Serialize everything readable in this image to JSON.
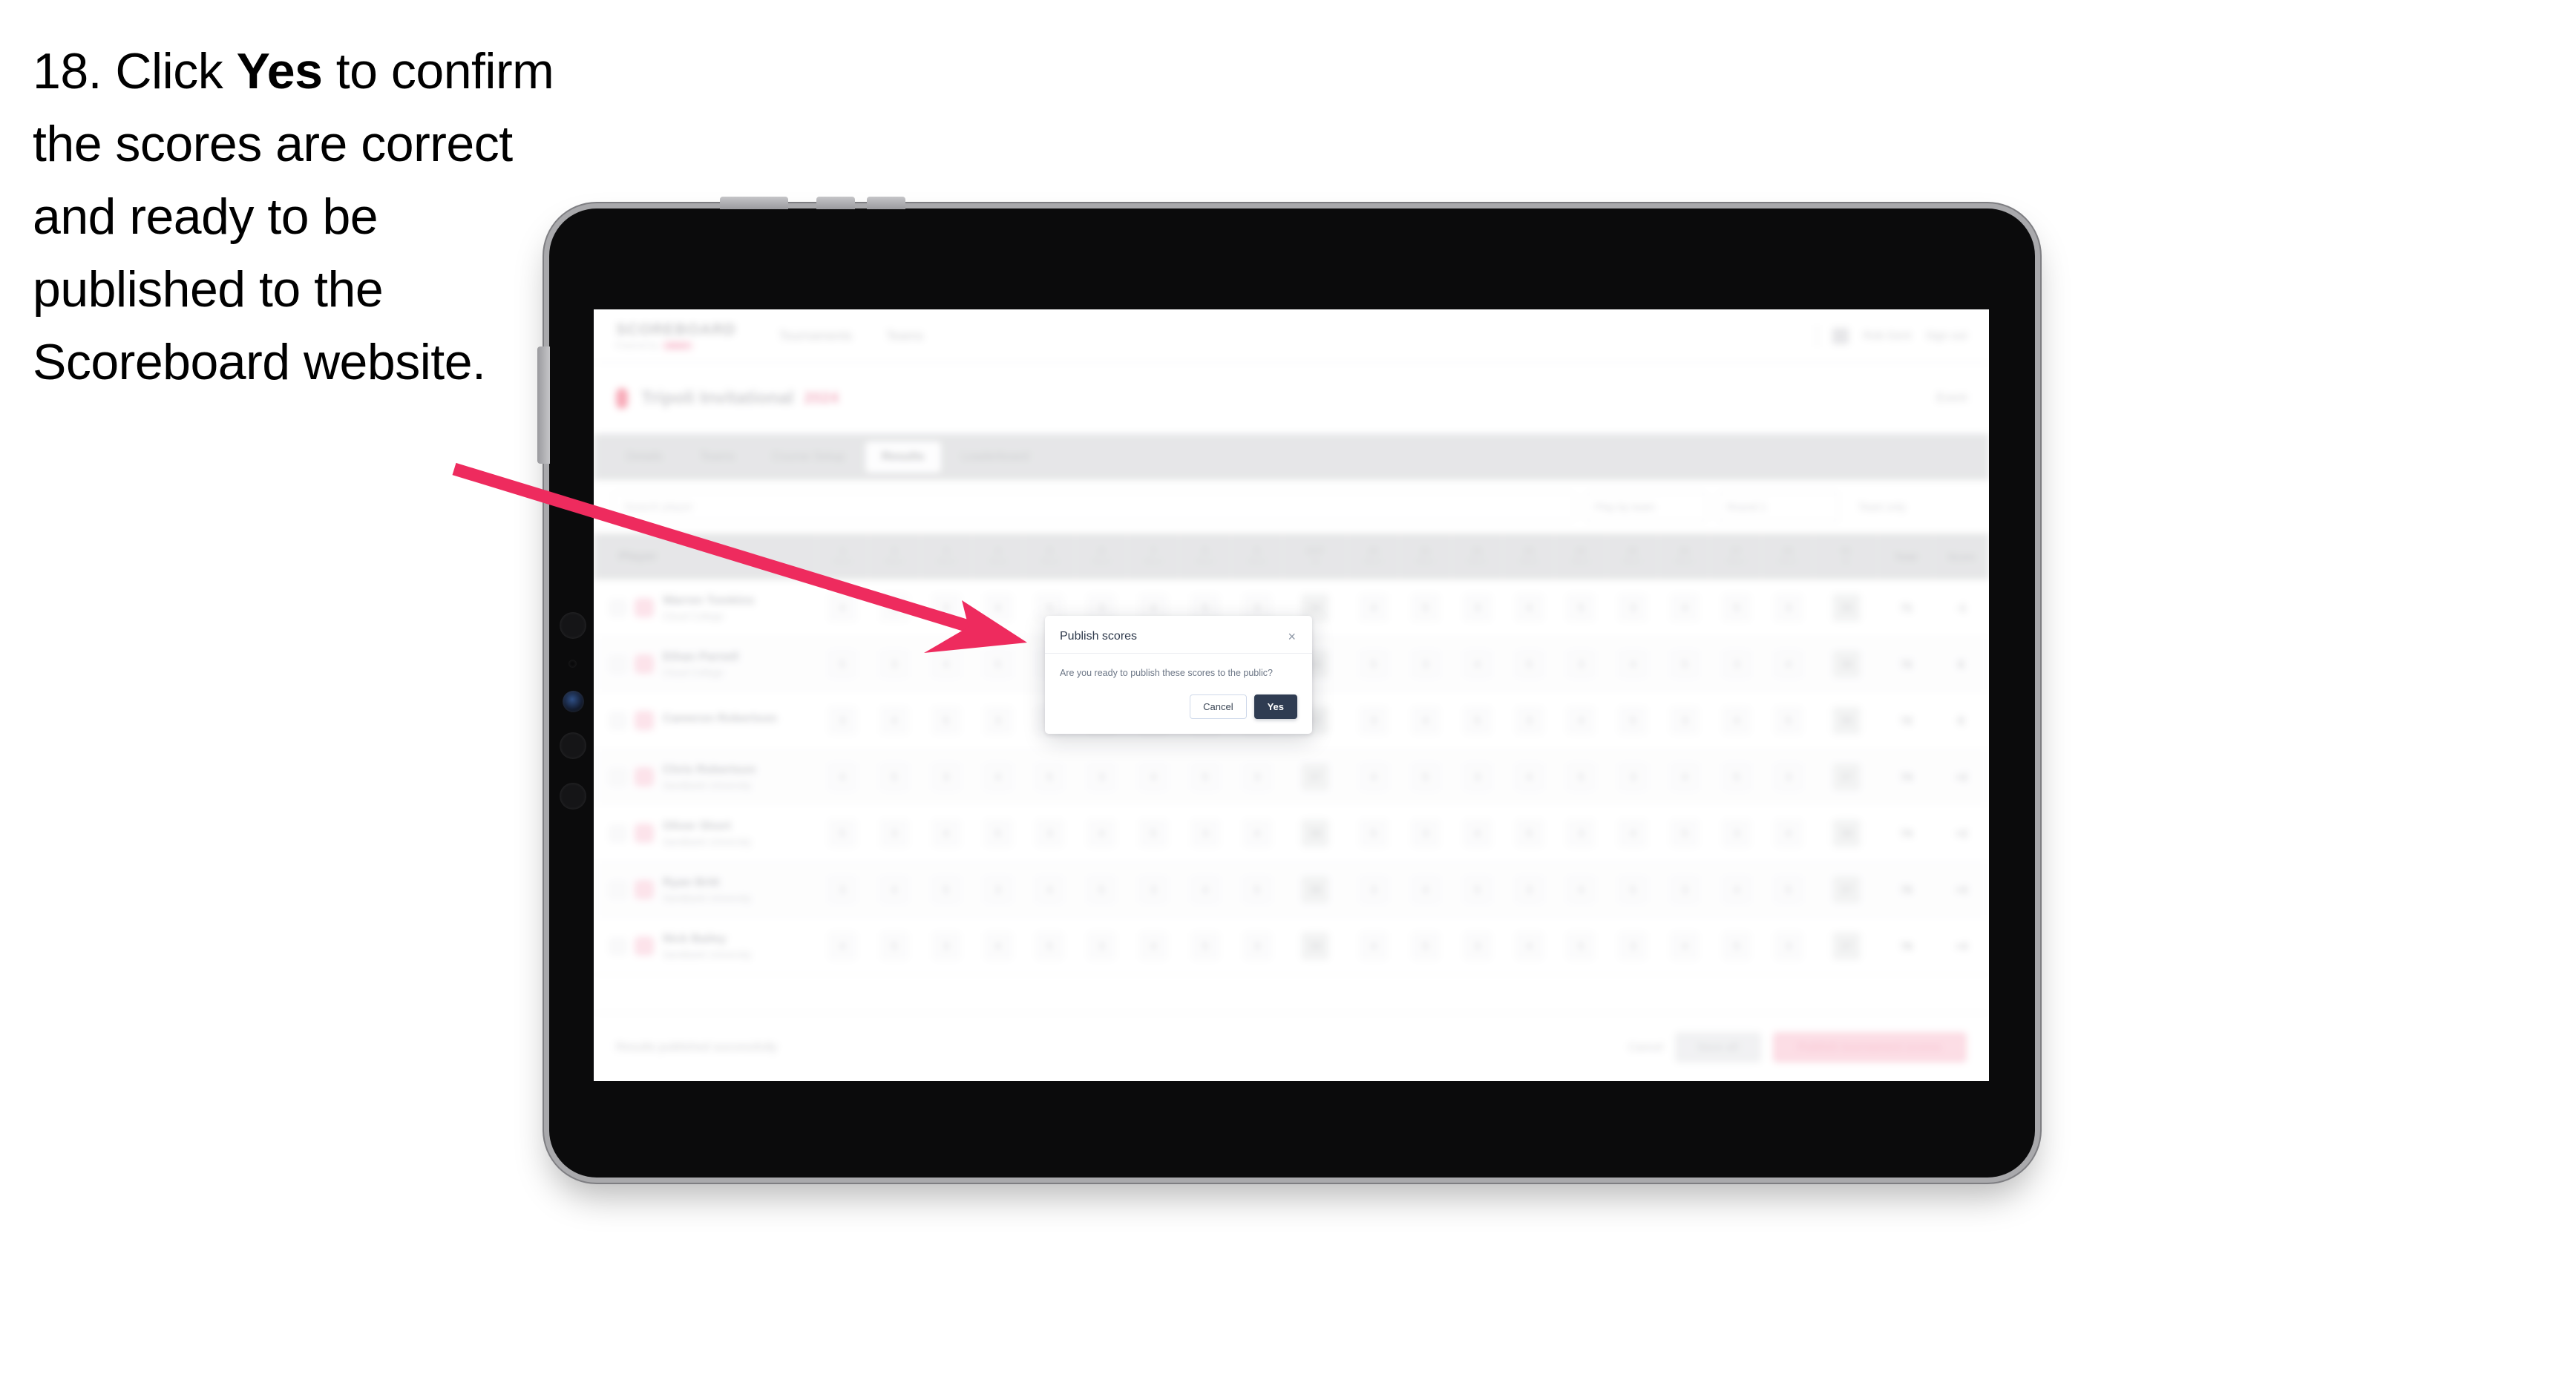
{
  "instruction": {
    "step_number": "18.",
    "before_bold": " Click ",
    "bold_word": "Yes",
    "after_bold": " to confirm the scores are correct and ready to be published to the Scoreboard website."
  },
  "callout": {
    "arrow_color": "#ee2b5e",
    "points_to": "Yes button in Publish scores dialog"
  },
  "device": {
    "type": "tablet",
    "body_color": "#0b0b0c",
    "bezel_color": "#a9a9ac"
  },
  "app": {
    "header": {
      "brand": "SCOREBOARD",
      "brand_sub": "Powered by",
      "brand_sub_pill": "GOLF",
      "nav": [
        "Tournaments",
        "Teams"
      ],
      "user_name": "Rob Gent",
      "sign_out": "Sign out"
    },
    "event": {
      "title": "Tripoli Invitational",
      "status": "2024",
      "right_action": "Event"
    },
    "tabs": [
      {
        "label": "Details",
        "active": false
      },
      {
        "label": "Teams",
        "active": false
      },
      {
        "label": "Course Setup",
        "active": false
      },
      {
        "label": "Results",
        "active": true
      },
      {
        "label": "Leaderboard",
        "active": false
      }
    ],
    "filters": {
      "search_placeholder": "Search player",
      "round_select": "Play by team",
      "division_select": "Round 1",
      "sort_select": "Team only"
    },
    "table": {
      "player_column": "Player",
      "holes": [
        {
          "n": "1",
          "p": "Par 4"
        },
        {
          "n": "2",
          "p": "Par 4"
        },
        {
          "n": "3",
          "p": "Par 3"
        },
        {
          "n": "4",
          "p": "Par 5"
        },
        {
          "n": "5",
          "p": "Par 4"
        },
        {
          "n": "6",
          "p": "Par 4"
        },
        {
          "n": "7",
          "p": "Par 3"
        },
        {
          "n": "8",
          "p": "Par 4"
        },
        {
          "n": "9",
          "p": "Par 5"
        },
        {
          "n": "OUT",
          "p": "36"
        },
        {
          "n": "10",
          "p": "Par 4"
        },
        {
          "n": "11",
          "p": "Par 4"
        },
        {
          "n": "12",
          "p": "Par 3"
        },
        {
          "n": "13",
          "p": "Par 5"
        },
        {
          "n": "14",
          "p": "Par 4"
        },
        {
          "n": "15",
          "p": "Par 4"
        },
        {
          "n": "16",
          "p": "Par 3"
        },
        {
          "n": "17",
          "p": "Par 4"
        },
        {
          "n": "18",
          "p": "Par 5"
        },
        {
          "n": "IN",
          "p": "36"
        }
      ],
      "end_columns": [
        "Total",
        "Score"
      ],
      "rows": [
        {
          "name": "Warren Tomkins",
          "team": "Cloud College",
          "out": "36",
          "in": "35",
          "total": "71",
          "score": "-1"
        },
        {
          "name": "Ethan Parnell",
          "team": "Cloud College",
          "out": "36",
          "in": "36",
          "total": "72",
          "score": "E"
        },
        {
          "name": "Cameron Robertson",
          "team": "",
          "out": "37",
          "in": "35",
          "total": "72",
          "score": "E"
        },
        {
          "name": "Chris Robertson",
          "team": "Sandbank University",
          "out": "37",
          "in": "37",
          "total": "74",
          "score": "+2"
        },
        {
          "name": "Oliver Short",
          "team": "Sandbank University",
          "out": "38",
          "in": "36",
          "total": "74",
          "score": "+2"
        },
        {
          "name": "Ryan Britt",
          "team": "Sandbank University",
          "out": "38",
          "in": "37",
          "total": "75",
          "score": "+3"
        },
        {
          "name": "Nick Bailey",
          "team": "Sandbank University",
          "out": "39",
          "in": "37",
          "total": "76",
          "score": "+4"
        }
      ]
    },
    "action_bar": {
      "note": "Results published successfully",
      "cancel": "Cancel",
      "save": "Save all",
      "publish": "Publish tournament scores"
    }
  },
  "modal": {
    "title": "Publish scores",
    "close_icon": "×",
    "message": "Are you ready to publish these scores to the public?",
    "cancel_label": "Cancel",
    "confirm_label": "Yes",
    "confirm_color": "#2f3c52"
  }
}
